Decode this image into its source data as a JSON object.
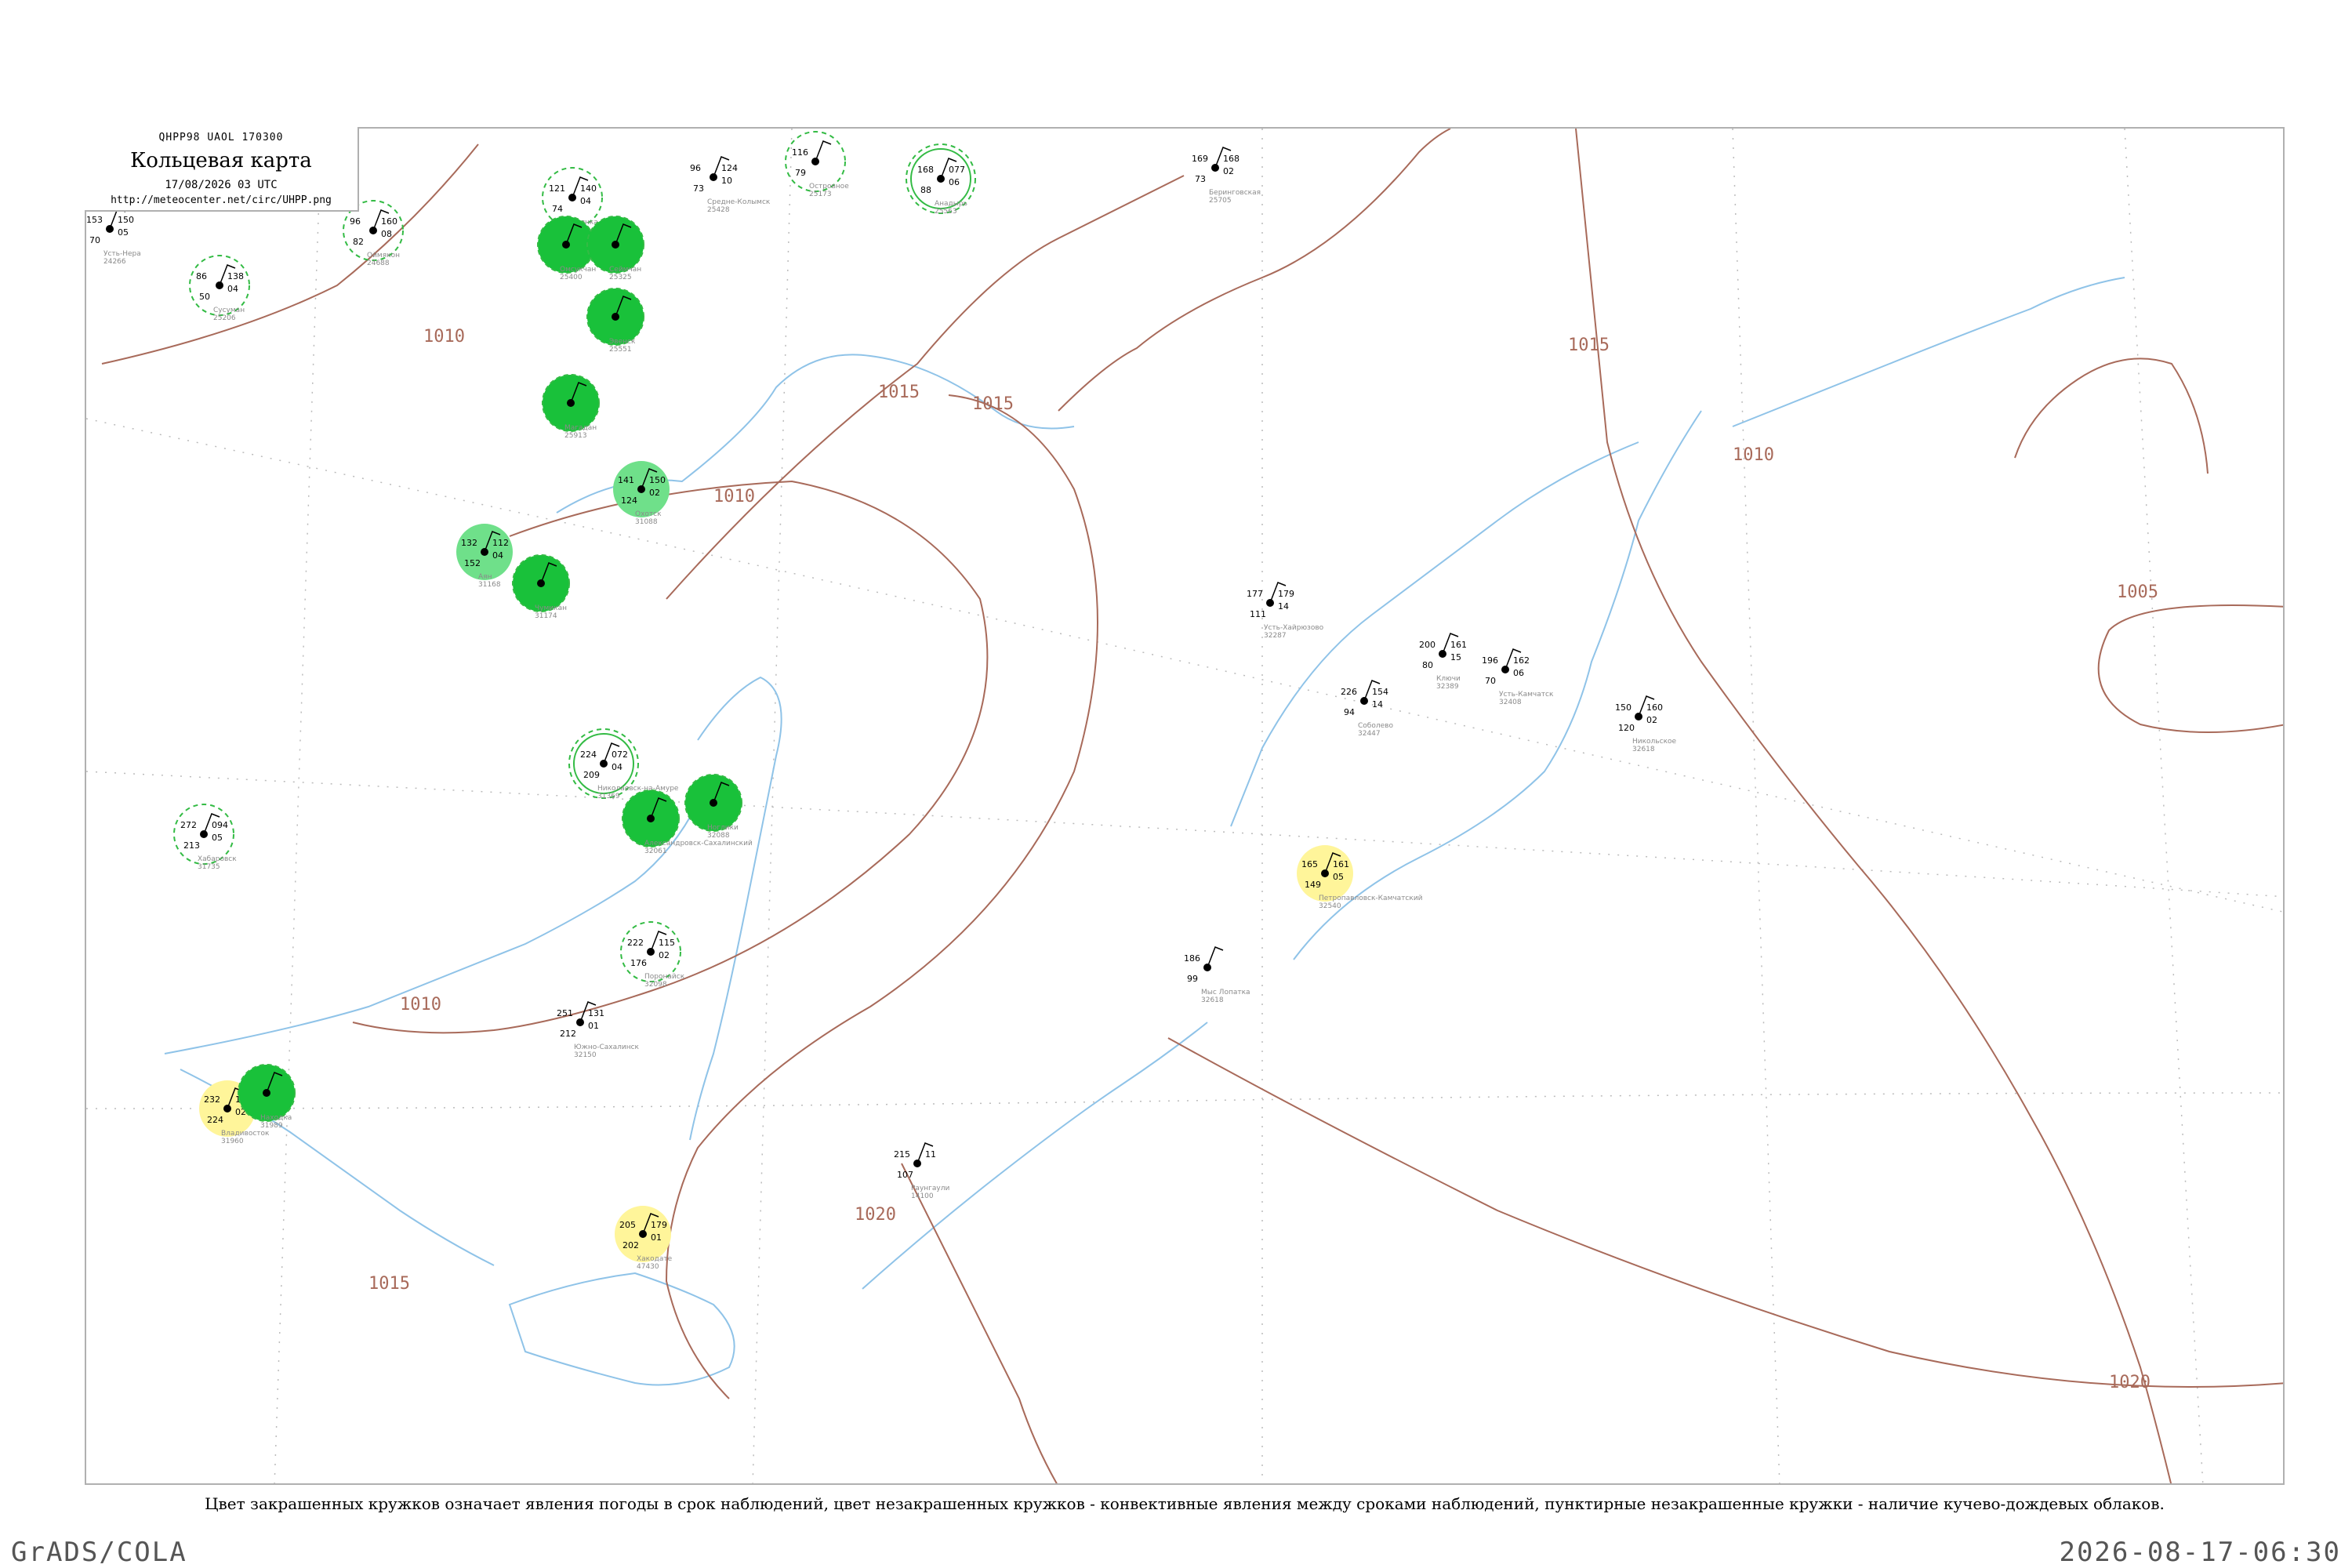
{
  "header": {
    "code": "QHPP98  UAOL  170300",
    "title": "Кольцевая карта",
    "date": "17/08/2026 03 UTC",
    "url": "http://meteocenter.net/circ/UHPP.png"
  },
  "caption": "Цвет закрашенных кружков означает явления погоды в срок наблюдений, цвет незакрашенных кружков - конвективные явления между сроками наблюдений, пунктирные незакрашенные кружки - наличие кучево-дождевых облаков.",
  "footer": {
    "left": "GrADS/COLA",
    "right": "2026-08-17-06:30"
  },
  "colors": {
    "isobar": "#a86a5a",
    "coast": "#8fc3e8",
    "fill_strong": "#19c13a",
    "fill_light": "#6fe08a",
    "fill_yellow": "#fff59a",
    "ring": "#33bb44"
  },
  "isobars": [
    "1010",
    "1015",
    "1015",
    "1010",
    "1015",
    "1010",
    "1020",
    "1005",
    "1010",
    "1020",
    "1015"
  ],
  "stations": [
    {
      "name": "Зырянка",
      "id": "25400",
      "t": "121",
      "td": "74",
      "p": "140",
      "dp": "04",
      "mark": "ring"
    },
    {
      "name": "Средне-Колымск",
      "id": "25428",
      "t": "96",
      "td": "73",
      "p": "124",
      "dp": "10",
      "mark": "none"
    },
    {
      "name": "Островное",
      "id": "25173",
      "t": "116",
      "td": "79",
      "p": "",
      "dp": "",
      "mark": "ring"
    },
    {
      "name": "Анадырь",
      "id": "25563",
      "t": "168",
      "td": "88",
      "p": "077",
      "dp": "06",
      "mark": "ring-solid"
    },
    {
      "name": "Беринговская",
      "id": "25705",
      "t": "169",
      "td": "73",
      "p": "168",
      "dp": "02",
      "mark": "none"
    },
    {
      "name": "Усть-Нера",
      "id": "24266",
      "t": "153",
      "td": "70",
      "p": "150",
      "dp": "05",
      "mark": "none"
    },
    {
      "name": "Оймякон",
      "id": "24688",
      "t": "96",
      "td": "82",
      "p": "160",
      "dp": "08",
      "mark": "ring"
    },
    {
      "name": "Сусуман",
      "id": "25206",
      "t": "86",
      "td": "50",
      "p": "138",
      "dp": "04",
      "mark": "ring"
    },
    {
      "name": "Омсукчан",
      "id": "25400",
      "t": "",
      "td": "",
      "p": "",
      "dp": "",
      "mark": "fill-strong"
    },
    {
      "name": "Сеймчан",
      "id": "25325",
      "t": "",
      "td": "",
      "p": "",
      "dp": "",
      "mark": "fill-strong"
    },
    {
      "name": "Эвенск",
      "id": "25551",
      "t": "",
      "td": "",
      "p": "",
      "dp": "",
      "mark": "fill-strong"
    },
    {
      "name": "Магадан",
      "id": "25913",
      "t": "",
      "td": "",
      "p": "",
      "dp": "",
      "mark": "fill-strong"
    },
    {
      "name": "Охотск",
      "id": "31088",
      "t": "141",
      "td": "124",
      "p": "150",
      "dp": "02",
      "mark": "fill-light"
    },
    {
      "name": "Аян",
      "id": "31168",
      "t": "132",
      "td": "152",
      "p": "112",
      "dp": "04",
      "mark": "fill-light"
    },
    {
      "name": "Чумикан",
      "id": "31174",
      "t": "",
      "td": "",
      "p": "",
      "dp": "",
      "mark": "fill-strong"
    },
    {
      "name": "Николаевск-на-Амуре",
      "id": "31369",
      "t": "224",
      "td": "209",
      "p": "072",
      "dp": "04",
      "mark": "ring-solid"
    },
    {
      "name": "Александровск-Сахалинский",
      "id": "32061",
      "t": "",
      "td": "",
      "p": "",
      "dp": "",
      "mark": "fill-strong"
    },
    {
      "name": "Ноглики",
      "id": "32088",
      "t": "",
      "td": "",
      "p": "",
      "dp": "",
      "mark": "fill-strong"
    },
    {
      "name": "Поронайск",
      "id": "32098",
      "t": "222",
      "td": "176",
      "p": "115",
      "dp": "02",
      "mark": "ring"
    },
    {
      "name": "Южно-Сахалинск",
      "id": "32150",
      "t": "251",
      "td": "212",
      "p": "131",
      "dp": "01",
      "mark": "none"
    },
    {
      "name": "Петропавловск-Камчатский",
      "id": "32540",
      "t": "165",
      "td": "149",
      "p": "161",
      "dp": "05",
      "mark": "fill-yellow"
    },
    {
      "name": "Усть-Камчатск",
      "id": "32408",
      "t": "196",
      "td": "70",
      "p": "162",
      "dp": "06",
      "mark": "none"
    },
    {
      "name": "Ключи",
      "id": "32389",
      "t": "200",
      "td": "80",
      "p": "161",
      "dp": "15",
      "mark": "none"
    },
    {
      "name": "Усть-Хайрюзово",
      "id": "32287",
      "t": "177",
      "td": "111",
      "p": "179",
      "dp": "14",
      "mark": "none"
    },
    {
      "name": "Соболево",
      "id": "32447",
      "t": "226",
      "td": "94",
      "p": "154",
      "dp": "14",
      "mark": "none"
    },
    {
      "name": "Мыс Лопатка",
      "id": "32618",
      "t": "186",
      "td": "99",
      "p": "",
      "dp": "",
      "mark": "none"
    },
    {
      "name": "Никольское",
      "id": "32618",
      "t": "150",
      "td": "120",
      "p": "160",
      "dp": "02",
      "mark": "none"
    },
    {
      "name": "Владивосток",
      "id": "31960",
      "t": "232",
      "td": "224",
      "p": "118",
      "dp": "02",
      "mark": "fill-yellow"
    },
    {
      "name": "Находка",
      "id": "31989",
      "t": "",
      "td": "",
      "p": "",
      "dp": "",
      "mark": "fill-strong"
    },
    {
      "name": "Хабаровск",
      "id": "31735",
      "t": "272",
      "td": "213",
      "p": "094",
      "dp": "05",
      "mark": "ring"
    },
    {
      "name": "Хакодате",
      "id": "47430",
      "t": "205",
      "td": "202",
      "p": "179",
      "dp": "01",
      "mark": "fill-yellow"
    },
    {
      "name": "Раунгаули",
      "id": "14100",
      "t": "215",
      "td": "107",
      "p": "11",
      "dp": "",
      "mark": "none"
    }
  ]
}
